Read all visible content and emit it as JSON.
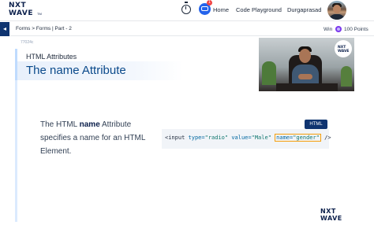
{
  "header": {
    "logo_line1": "NXT",
    "logo_line2": "WAVE",
    "logo_tm": "TM",
    "notification_count": "1",
    "nav_home": "Home",
    "nav_code_playground": "Code Playground",
    "user_name": "Durgaprasad",
    "icons": [
      "stopwatch-icon",
      "chat-icon",
      "avatar"
    ]
  },
  "subheader": {
    "menu_icon": "◂",
    "breadcrumb": "Forms > Forms | Part - 2",
    "win_label": "Win",
    "points": "100 Points",
    "coin_color": "#7c3aed"
  },
  "slide": {
    "id_text": "77024c",
    "subtitle": "HTML Attributes",
    "title": "The name Attribute",
    "desc_pre": "The HTML ",
    "desc_bold": "name",
    "desc_post": " Attribute specifies a name for an HTML Element.",
    "code_tag": "HTML",
    "code": {
      "open": "<input",
      "attr1": "type=",
      "val1": "\"radio\"",
      "attr2": "value=",
      "val2": "\"Male\"",
      "attr3": "name=",
      "val3": "\"gender\"",
      "close": "/>"
    },
    "accent_color": "#0b4a8b",
    "highlight_color": "#f59e0b"
  },
  "video": {
    "logo_line1": "NXT",
    "logo_line2": "WAVE"
  },
  "footer": {
    "logo_line1": "NXT",
    "logo_line2": "WAVE"
  }
}
